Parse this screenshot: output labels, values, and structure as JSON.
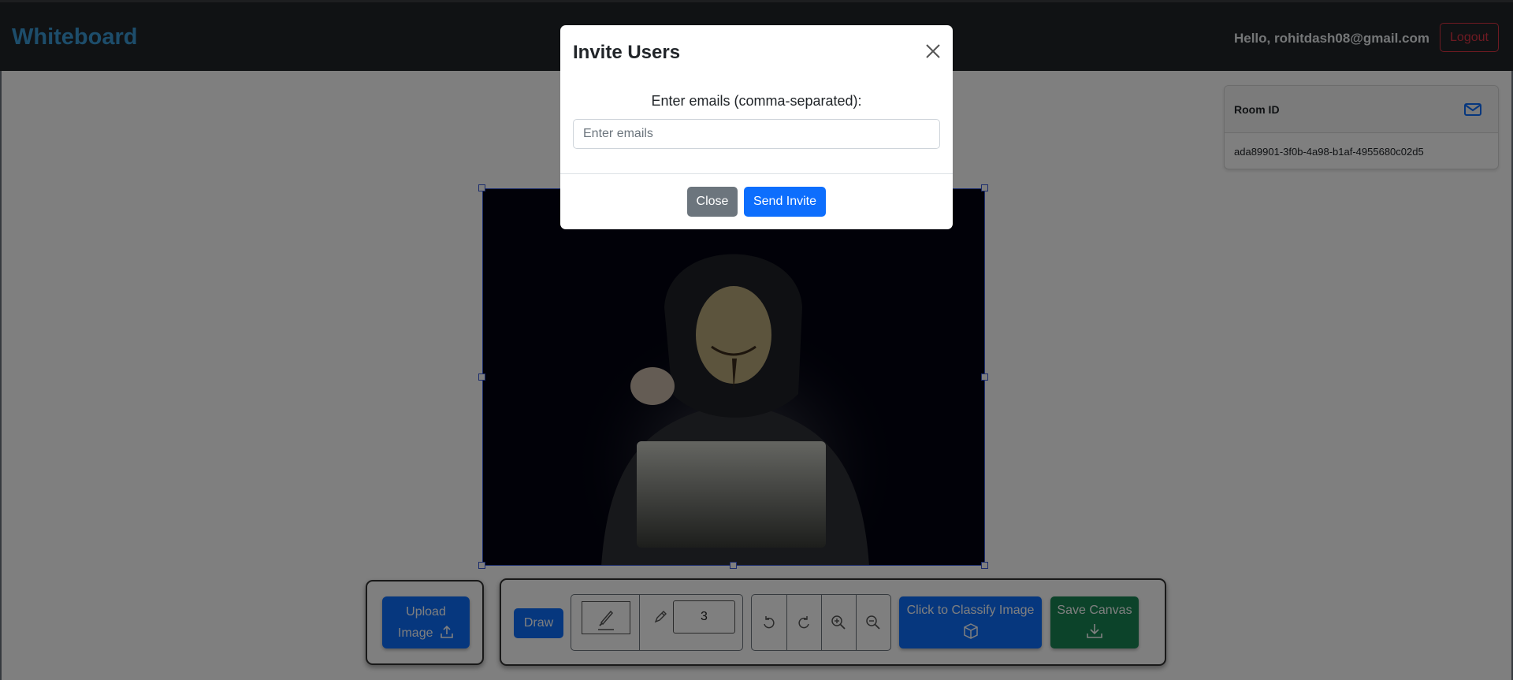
{
  "navbar": {
    "brand": "Whiteboard",
    "greeting": "Hello, rohitdash08@gmail.com",
    "logout_label": "Logout"
  },
  "room": {
    "title": "Room ID",
    "id": "ada89901-3f0b-4a98-b1af-4955680c02d5",
    "invite_icon": "envelope-icon"
  },
  "toolbar": {
    "upload_label_line1": "Upload",
    "upload_label_line2": "Image",
    "draw_label": "Draw",
    "brush_size": "3",
    "classify_label": "Click to Classify Image",
    "save_label": "Save Canvas"
  },
  "modal": {
    "title": "Invite Users",
    "label": "Enter emails (comma-separated):",
    "input_placeholder": "Enter emails",
    "input_value": "",
    "close_label": "Close",
    "send_label": "Send Invite"
  },
  "colors": {
    "primary": "#0d6efd",
    "success": "#198754",
    "secondary": "#6c757d",
    "danger": "#dc3545",
    "brand": "#3a9ad6",
    "navbar": "#212529"
  }
}
